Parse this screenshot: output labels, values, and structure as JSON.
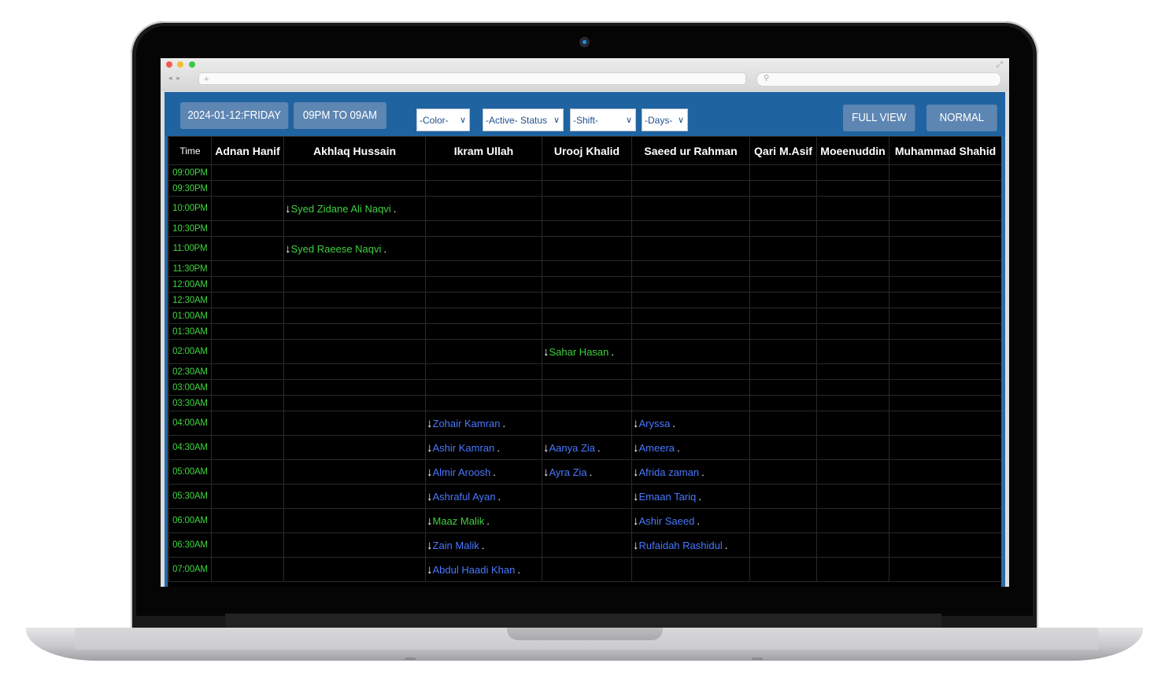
{
  "toolbar": {
    "date_label": "2024-01-12:FRIDAY",
    "shift_range_label": "09PM TO 09AM",
    "color_select": "-Color-",
    "status_select": "-Active- Status",
    "shift_select": "-Shift-",
    "days_select": "-Days-",
    "full_view_label": "FULL VIEW",
    "normal_label": "NORMAL"
  },
  "columns": [
    "Time",
    "Adnan Hanif",
    "Akhlaq Hussain",
    "Ikram Ullah",
    "Urooj Khalid",
    "Saeed ur Rahman",
    "Qari M.Asif",
    "Moeenuddin",
    "Muhammad Shahid"
  ],
  "rows": [
    {
      "time": "09:00PM",
      "cells": {}
    },
    {
      "time": "09:30PM",
      "cells": {}
    },
    {
      "time": "10:00PM",
      "cells": {
        "1": {
          "name": "Syed Zidane Ali Naqvi",
          "color": "green"
        }
      }
    },
    {
      "time": "10:30PM",
      "cells": {}
    },
    {
      "time": "11:00PM",
      "cells": {
        "1": {
          "name": "Syed Raeese Naqvi",
          "color": "green"
        }
      }
    },
    {
      "time": "11:30PM",
      "cells": {}
    },
    {
      "time": "12:00AM",
      "cells": {}
    },
    {
      "time": "12:30AM",
      "cells": {}
    },
    {
      "time": "01:00AM",
      "cells": {}
    },
    {
      "time": "01:30AM",
      "cells": {}
    },
    {
      "time": "02:00AM",
      "cells": {
        "3": {
          "name": "Sahar Hasan",
          "color": "green"
        }
      }
    },
    {
      "time": "02:30AM",
      "cells": {}
    },
    {
      "time": "03:00AM",
      "cells": {}
    },
    {
      "time": "03:30AM",
      "cells": {}
    },
    {
      "time": "04:00AM",
      "cells": {
        "2": {
          "name": "Zohair Kamran",
          "color": "blue"
        },
        "4": {
          "name": "Aryssa",
          "color": "blue"
        }
      }
    },
    {
      "time": "04:30AM",
      "cells": {
        "2": {
          "name": "Ashir Kamran",
          "color": "blue"
        },
        "3": {
          "name": "Aanya Zia",
          "color": "blue"
        },
        "4": {
          "name": "Ameera",
          "color": "blue"
        }
      }
    },
    {
      "time": "05:00AM",
      "cells": {
        "2": {
          "name": "Almir Aroosh",
          "color": "blue"
        },
        "3": {
          "name": "Ayra Zia",
          "color": "blue"
        },
        "4": {
          "name": "Afrida zaman",
          "color": "blue"
        }
      }
    },
    {
      "time": "05:30AM",
      "cells": {
        "2": {
          "name": "Ashraful Ayan",
          "color": "blue"
        },
        "4": {
          "name": "Emaan Tariq",
          "color": "blue"
        }
      }
    },
    {
      "time": "06:00AM",
      "cells": {
        "2": {
          "name": "Maaz Malik",
          "color": "green"
        },
        "4": {
          "name": "Ashir Saeed",
          "color": "blue"
        }
      }
    },
    {
      "time": "06:30AM",
      "cells": {
        "2": {
          "name": "Zain Malik",
          "color": "blue"
        },
        "4": {
          "name": "Rufaidah Rashidul",
          "color": "blue"
        }
      }
    },
    {
      "time": "07:00AM",
      "cells": {
        "2": {
          "name": "Abdul Haadi Khan",
          "color": "blue"
        }
      }
    }
  ],
  "colors": {
    "time": "#3fd43f",
    "green_entry": "#3fcf3f",
    "blue_entry": "#4a78ff",
    "toolbar": "#1f63a1",
    "button": "#5d86b3"
  }
}
